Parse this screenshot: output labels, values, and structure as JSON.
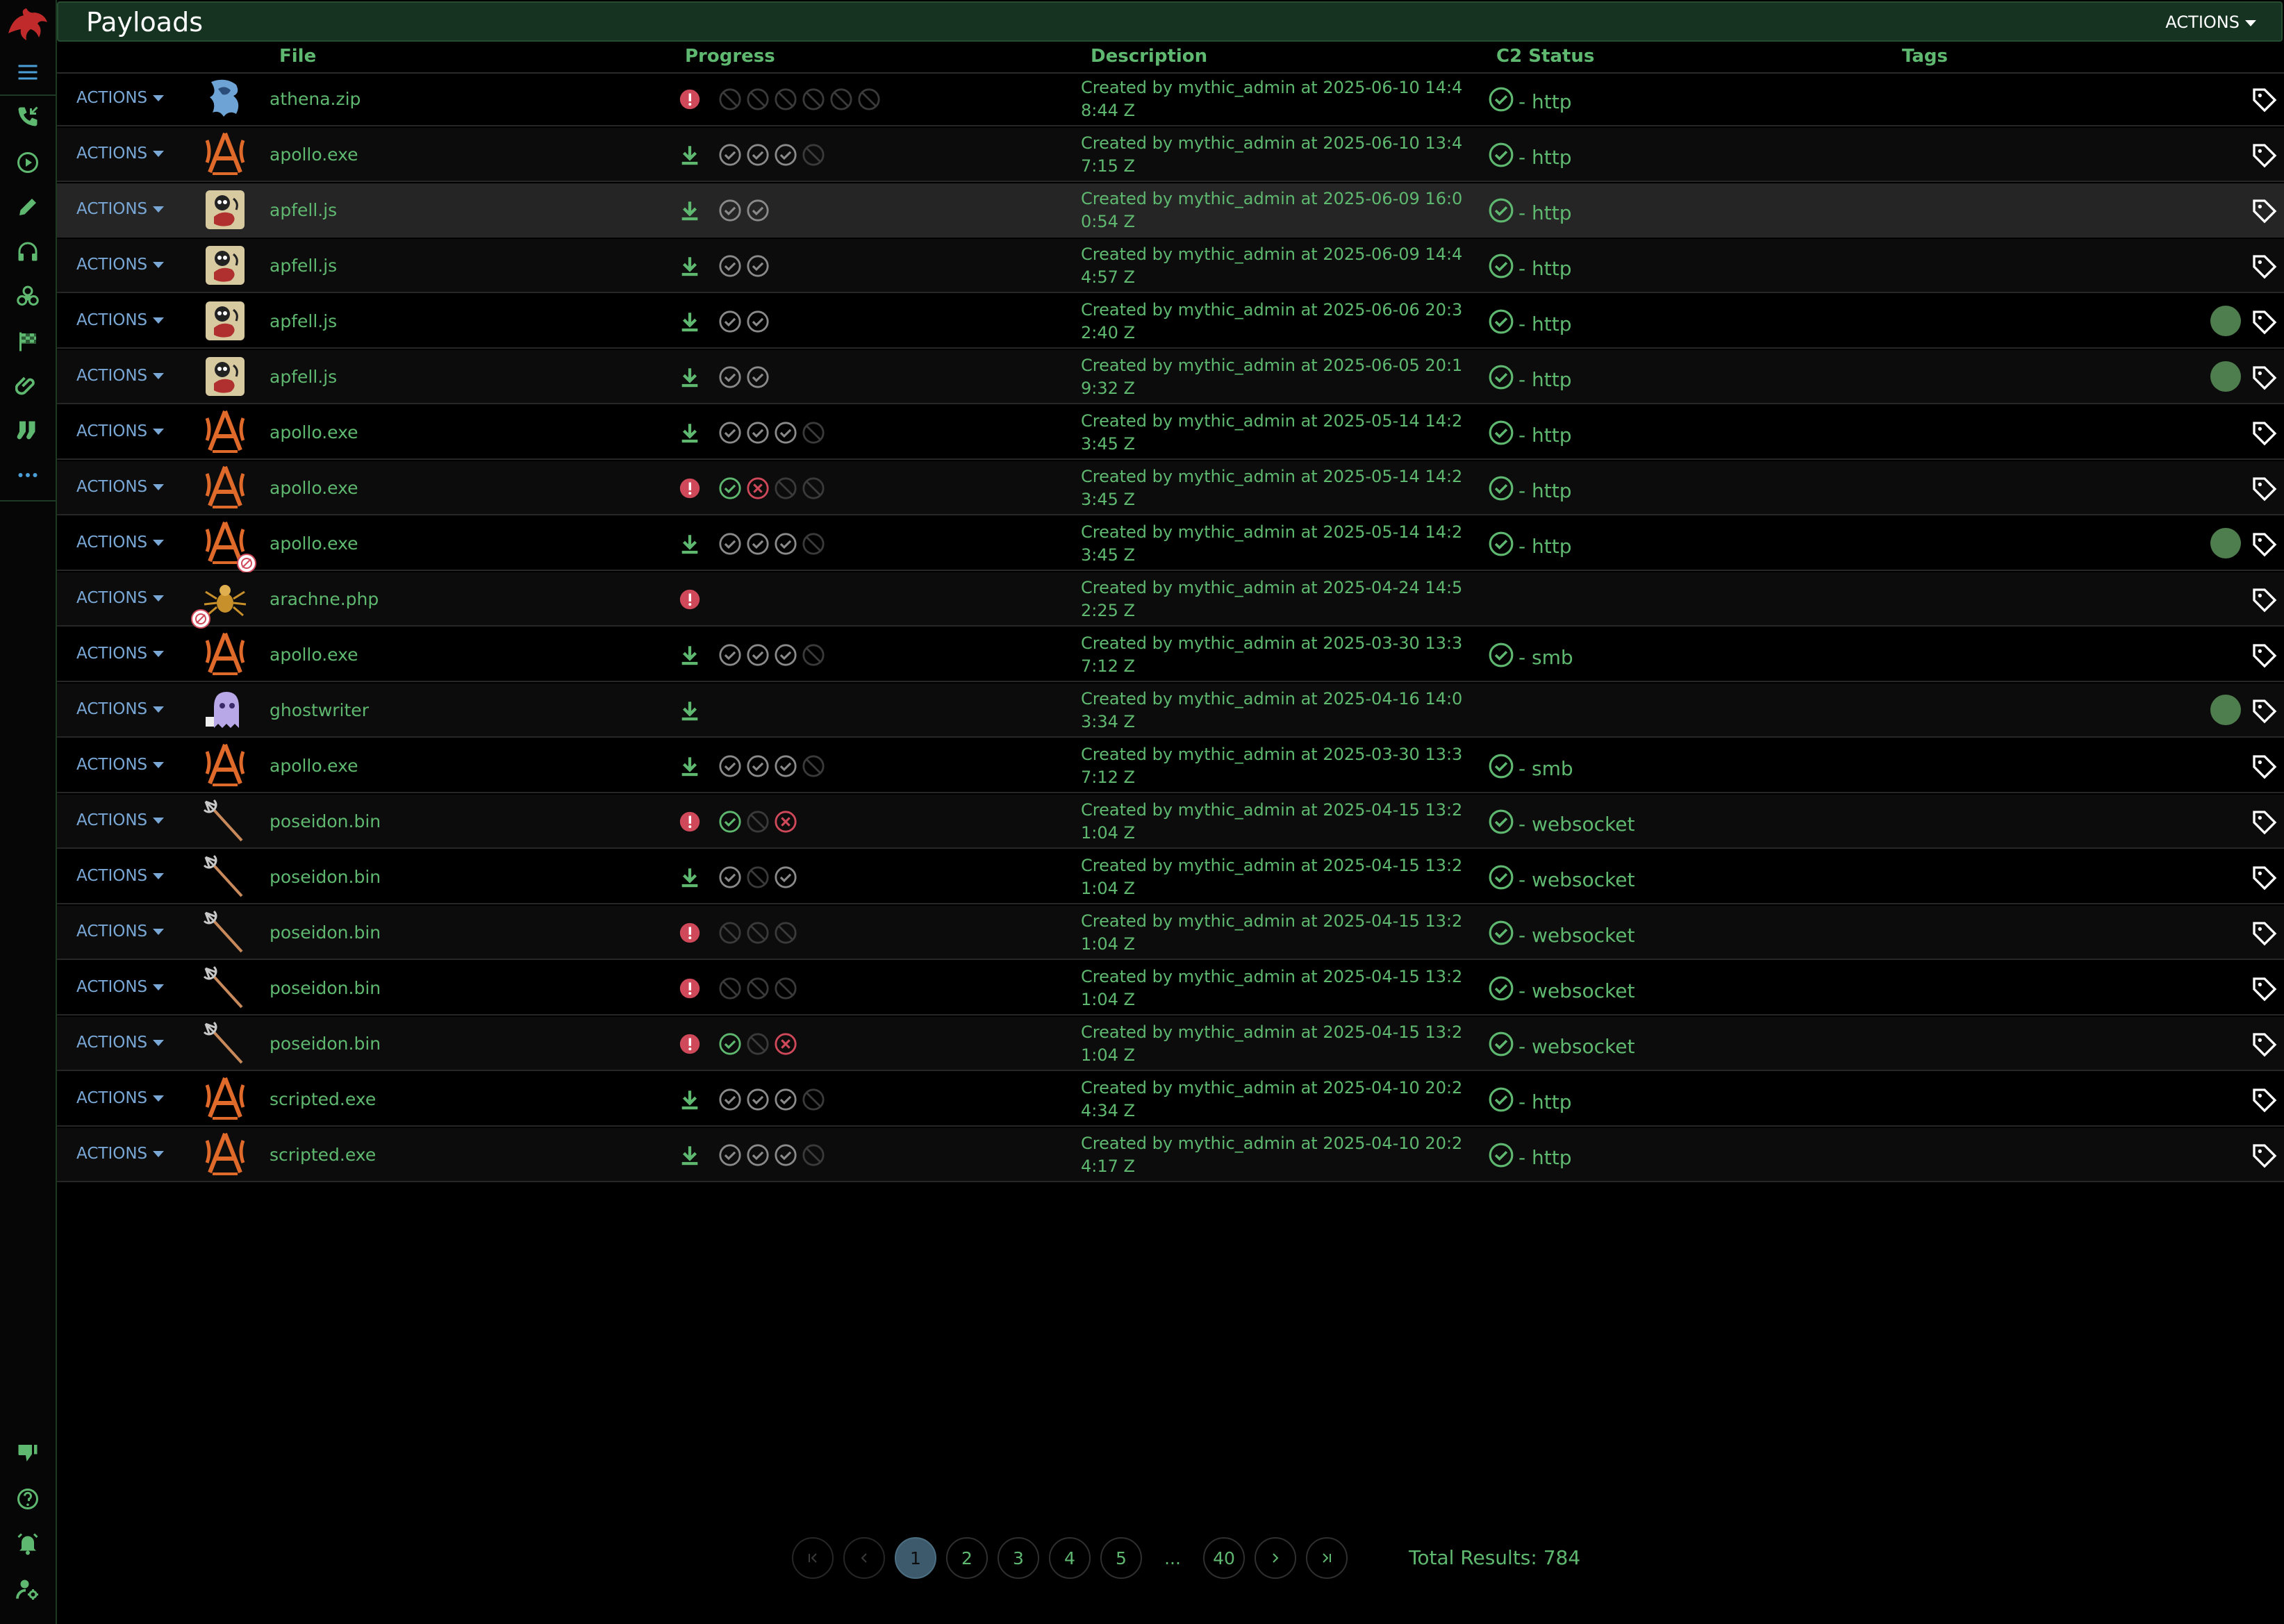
{
  "header": {
    "title": "Payloads",
    "actions_label": "ACTIONS"
  },
  "columns": {
    "file": "File",
    "progress": "Progress",
    "description": "Description",
    "c2": "C2 Status",
    "tags": "Tags"
  },
  "row_action_label": "ACTIONS",
  "rows": [
    {
      "icon": "athena-icon",
      "file": "athena.zip",
      "status": "error",
      "steps": [
        "empty",
        "empty",
        "empty",
        "empty",
        "empty",
        "empty"
      ],
      "desc": "Created by mythic_admin at 2025-06-10 14:48:44 Z",
      "c2": "http",
      "tagdot": false
    },
    {
      "icon": "apollo-icon",
      "file": "apollo.exe",
      "status": "download",
      "steps": [
        "done",
        "done",
        "done",
        "empty"
      ],
      "desc": "Created by mythic_admin at 2025-06-10 13:47:15 Z",
      "c2": "http",
      "tagdot": false
    },
    {
      "icon": "apfell-icon",
      "file": "apfell.js",
      "status": "download",
      "steps": [
        "done",
        "done"
      ],
      "desc": "Created by mythic_admin at 2025-06-09 16:00:54 Z",
      "c2": "http",
      "tagdot": false
    },
    {
      "icon": "apfell-icon",
      "file": "apfell.js",
      "status": "download",
      "steps": [
        "done",
        "done"
      ],
      "desc": "Created by mythic_admin at 2025-06-09 14:44:57 Z",
      "c2": "http",
      "tagdot": false
    },
    {
      "icon": "apfell-icon",
      "file": "apfell.js",
      "status": "download",
      "steps": [
        "done",
        "done"
      ],
      "desc": "Created by mythic_admin at 2025-06-06 20:32:40 Z",
      "c2": "http",
      "tagdot": true
    },
    {
      "icon": "apfell-icon",
      "file": "apfell.js",
      "status": "download",
      "steps": [
        "done",
        "done"
      ],
      "desc": "Created by mythic_admin at 2025-06-05 20:19:32 Z",
      "c2": "http",
      "tagdot": true
    },
    {
      "icon": "apollo-icon",
      "file": "apollo.exe",
      "status": "download",
      "steps": [
        "done",
        "done",
        "done",
        "empty"
      ],
      "desc": "Created by mythic_admin at 2025-05-14 14:23:45 Z",
      "c2": "http",
      "tagdot": false
    },
    {
      "icon": "apollo-icon",
      "file": "apollo.exe",
      "status": "error",
      "steps": [
        "success",
        "failed",
        "empty",
        "empty"
      ],
      "desc": "Created by mythic_admin at 2025-05-14 14:23:45 Z",
      "c2": "http",
      "tagdot": false
    },
    {
      "icon": "apollo-icon",
      "file": "apollo.exe",
      "status": "download",
      "steps": [
        "done",
        "done",
        "done",
        "empty"
      ],
      "desc": "Created by mythic_admin at 2025-05-14 14:23:45 Z",
      "c2": "http",
      "tagdot": true,
      "badge": "right"
    },
    {
      "icon": "arachne-icon",
      "file": "arachne.php",
      "status": "error",
      "steps": [],
      "desc": "Created by mythic_admin at 2025-04-24 14:52:25 Z",
      "c2": "",
      "tagdot": false,
      "badge": "left"
    },
    {
      "icon": "apollo-icon",
      "file": "apollo.exe",
      "status": "download",
      "steps": [
        "done",
        "done",
        "done",
        "empty"
      ],
      "desc": "Created by mythic_admin at 2025-03-30 13:37:12 Z",
      "c2": "smb",
      "tagdot": false
    },
    {
      "icon": "ghost-icon",
      "file": "ghostwriter",
      "status": "download",
      "steps": [],
      "desc": "Created by mythic_admin at 2025-04-16 14:03:34 Z",
      "c2": "",
      "tagdot": true
    },
    {
      "icon": "apollo-icon",
      "file": "apollo.exe",
      "status": "download",
      "steps": [
        "done",
        "done",
        "done",
        "empty"
      ],
      "desc": "Created by mythic_admin at 2025-03-30 13:37:12 Z",
      "c2": "smb",
      "tagdot": false
    },
    {
      "icon": "poseidon-icon",
      "file": "poseidon.bin",
      "status": "error",
      "steps": [
        "success",
        "empty",
        "failed"
      ],
      "desc": "Created by mythic_admin at 2025-04-15 13:21:04 Z",
      "c2": "websocket",
      "tagdot": false
    },
    {
      "icon": "poseidon-icon",
      "file": "poseidon.bin",
      "status": "download",
      "steps": [
        "done",
        "empty",
        "done"
      ],
      "desc": "Created by mythic_admin at 2025-04-15 13:21:04 Z",
      "c2": "websocket",
      "tagdot": false
    },
    {
      "icon": "poseidon-icon",
      "file": "poseidon.bin",
      "status": "error",
      "steps": [
        "empty",
        "empty",
        "empty"
      ],
      "desc": "Created by mythic_admin at 2025-04-15 13:21:04 Z",
      "c2": "websocket",
      "tagdot": false
    },
    {
      "icon": "poseidon-icon",
      "file": "poseidon.bin",
      "status": "error",
      "steps": [
        "empty",
        "empty",
        "empty"
      ],
      "desc": "Created by mythic_admin at 2025-04-15 13:21:04 Z",
      "c2": "websocket",
      "tagdot": false
    },
    {
      "icon": "poseidon-icon",
      "file": "poseidon.bin",
      "status": "error",
      "steps": [
        "success",
        "empty",
        "failed"
      ],
      "desc": "Created by mythic_admin at 2025-04-15 13:21:04 Z",
      "c2": "websocket",
      "tagdot": false
    },
    {
      "icon": "apollo-icon",
      "file": "scripted.exe",
      "status": "download",
      "steps": [
        "done",
        "done",
        "done",
        "empty"
      ],
      "desc": "Created by mythic_admin at 2025-04-10 20:24:34 Z",
      "c2": "http",
      "tagdot": false
    },
    {
      "icon": "apollo-icon",
      "file": "scripted.exe",
      "status": "download",
      "steps": [
        "done",
        "done",
        "done",
        "empty"
      ],
      "desc": "Created by mythic_admin at 2025-04-10 20:24:17 Z",
      "c2": "http",
      "tagdot": false
    }
  ],
  "pagination": {
    "pages": [
      "1",
      "2",
      "3",
      "4",
      "5"
    ],
    "current": "1",
    "ellipsis": "...",
    "last": "40",
    "total": "Total Results: 784"
  },
  "colors": {
    "accent": "#5fb870",
    "error": "#d0495a",
    "link": "#7aa8d6",
    "apollo": "#e06a2a"
  },
  "sidebar_icons": [
    "menu-icon",
    "callbacks-phone-icon",
    "play-circle-icon",
    "pencil-icon",
    "headphones-icon",
    "biohazard-icon",
    "checkered-flag-icon",
    "paperclip-icon",
    "socks-icon",
    "more-icon",
    "thumbs-down-icon",
    "help-icon",
    "alarm-icon",
    "user-settings-icon"
  ]
}
